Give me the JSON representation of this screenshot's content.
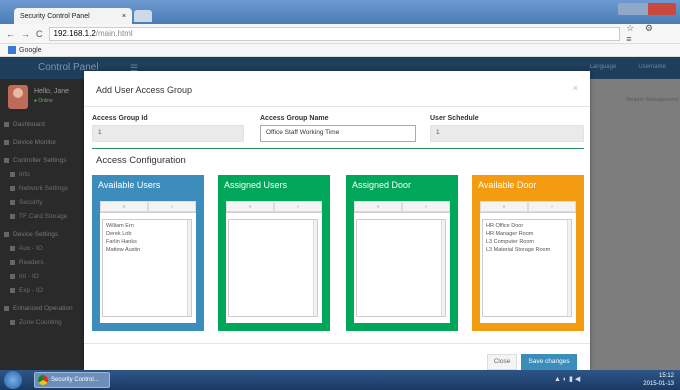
{
  "browser": {
    "tab_title": "Security Control Panel",
    "tab_close": "×",
    "url_host": "192.168.1.2",
    "url_path": "/main.html",
    "bookmark": "Google",
    "nav_back": "←",
    "nav_forward": "→",
    "nav_reload": "C",
    "nav_right": "☆ ⚙ ≡"
  },
  "app": {
    "brand": "Control Panel",
    "user_name": "Hello, Jane",
    "user_status": "● Online",
    "header_right_1": "Language",
    "header_right_2": "Username",
    "breadcrumb": "Reader Management",
    "sidebar": [
      {
        "label": "Dashboard",
        "sub": false
      },
      {
        "label": "Device Monitor",
        "sub": false
      },
      {
        "label": "Controller Settings",
        "sub": false
      },
      {
        "label": "Info",
        "sub": true
      },
      {
        "label": "Network Settings",
        "sub": true
      },
      {
        "label": "Security",
        "sub": true
      },
      {
        "label": "TF Card Storage",
        "sub": true
      },
      {
        "label": "Device Settings",
        "sub": false
      },
      {
        "label": "Aux - IO",
        "sub": true
      },
      {
        "label": "Readers",
        "sub": true
      },
      {
        "label": "Int - IO",
        "sub": true
      },
      {
        "label": "Exp - IO",
        "sub": true
      },
      {
        "label": "Enhanced Operation",
        "sub": false
      },
      {
        "label": "Zone Counting",
        "sub": true
      }
    ]
  },
  "modal": {
    "title": "Add User Access Group",
    "close_icon": "×",
    "fields": {
      "group_id_label": "Access Group Id",
      "group_id_value": "1",
      "group_name_label": "Access Group Name",
      "group_name_value": "Office Staff Working Time",
      "schedule_label": "User Schedule",
      "schedule_value": "1"
    },
    "section_title": "Access Configuration",
    "boxes": {
      "available_users": {
        "title": "Available Users",
        "btn_all": "»",
        "btn_one": "›",
        "items": [
          "William Ern",
          "Derek Lob",
          "Farlin Hanks",
          "Mattew Austin"
        ]
      },
      "assigned_users": {
        "title": "Assigned Users",
        "btn_all": "«",
        "btn_one": "‹",
        "items": []
      },
      "assigned_door": {
        "title": "Assigned Door",
        "btn_all": "«",
        "btn_one": "‹",
        "items": []
      },
      "available_door": {
        "title": "Available Door",
        "btn_all": "»",
        "btn_one": "›",
        "items": [
          "HR Office Door",
          "HR Manager Room",
          "L3 Computer Room",
          "L3 Material Storage Room"
        ]
      }
    },
    "close_button": "Close",
    "save_button": "Save changes"
  },
  "taskbar": {
    "task_label": "Security Control...",
    "time": "15:12",
    "date": "2015-01-13"
  },
  "colors": {
    "blue": "#3c8dbc",
    "green": "#00a65a",
    "orange": "#f39c12"
  }
}
